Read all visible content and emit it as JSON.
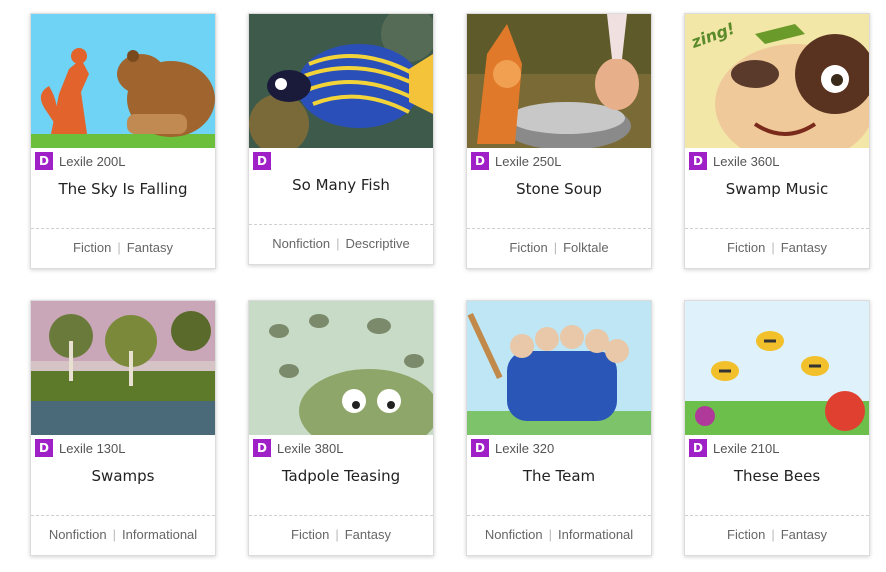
{
  "cards": [
    {
      "title": "The Sky Is Falling",
      "lexile": "Lexile 200L",
      "cat1": "Fiction",
      "cat2": "Fantasy",
      "badge": "D"
    },
    {
      "title": "So Many Fish",
      "lexile": "",
      "cat1": "Nonfiction",
      "cat2": "Descriptive",
      "badge": "D"
    },
    {
      "title": "Stone Soup",
      "lexile": "Lexile 250L",
      "cat1": "Fiction",
      "cat2": "Folktale",
      "badge": "D"
    },
    {
      "title": "Swamp Music",
      "lexile": "Lexile 360L",
      "cat1": "Fiction",
      "cat2": "Fantasy",
      "badge": "D"
    },
    {
      "title": "Swamps",
      "lexile": "Lexile 130L",
      "cat1": "Nonfiction",
      "cat2": "Informational",
      "badge": "D"
    },
    {
      "title": "Tadpole Teasing",
      "lexile": "Lexile 380L",
      "cat1": "Fiction",
      "cat2": "Fantasy",
      "badge": "D"
    },
    {
      "title": "The Team",
      "lexile": "Lexile 320",
      "cat1": "Nonfiction",
      "cat2": "Informational",
      "badge": "D"
    },
    {
      "title": "These Bees",
      "lexile": "Lexile 210L",
      "cat1": "Fiction",
      "cat2": "Fantasy",
      "badge": "D"
    }
  ],
  "illustration_text": {
    "swamp_music_zing": "zing!"
  },
  "colors": {
    "badge": "#a020c8"
  }
}
